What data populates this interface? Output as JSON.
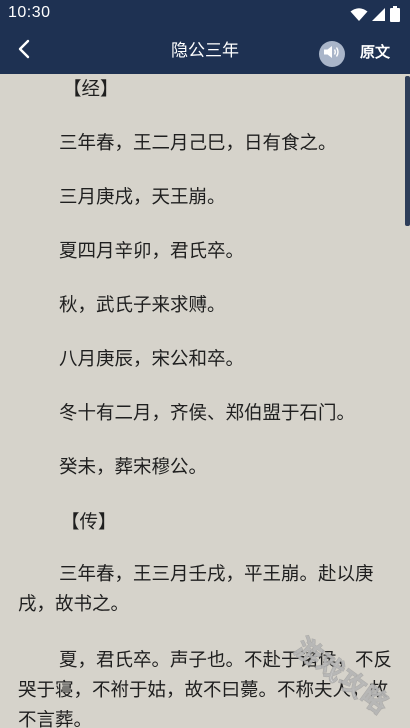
{
  "status": {
    "time": "10:30",
    "icons": [
      "wifi-icon",
      "signal-icon",
      "battery-icon"
    ]
  },
  "nav": {
    "back_icon": "chevron-left-icon",
    "title": "隐公三年",
    "audio_icon": "speaker-icon",
    "original_label": "原文"
  },
  "content": {
    "jing_heading": "【经】",
    "jing_lines": [
      "三年春，王二月己巳，日有食之。",
      "三月庚戌，天王崩。",
      "夏四月辛卯，君氏卒。",
      "秋，武氏子来求赙。",
      "八月庚辰，宋公和卒。",
      "冬十有二月，齐侯、郑伯盟于石门。",
      "癸未，葬宋穆公。"
    ],
    "zhuan_heading": "【传】",
    "zhuan_paragraphs": [
      "三年春，王三月壬戌，平王崩。赴以庚戌，故书之。",
      "夏，君氏卒。声子也。不赴于诸侯，不反哭于寝，不祔于姑，故不曰薨。不称夫人，故不言葬。"
    ]
  },
  "watermark": "游戏攻略",
  "colors": {
    "header": "#1e3152",
    "page_background": "#d6d3cb",
    "text": "#1f1f1f",
    "audio_button": "#a9b5c9"
  }
}
